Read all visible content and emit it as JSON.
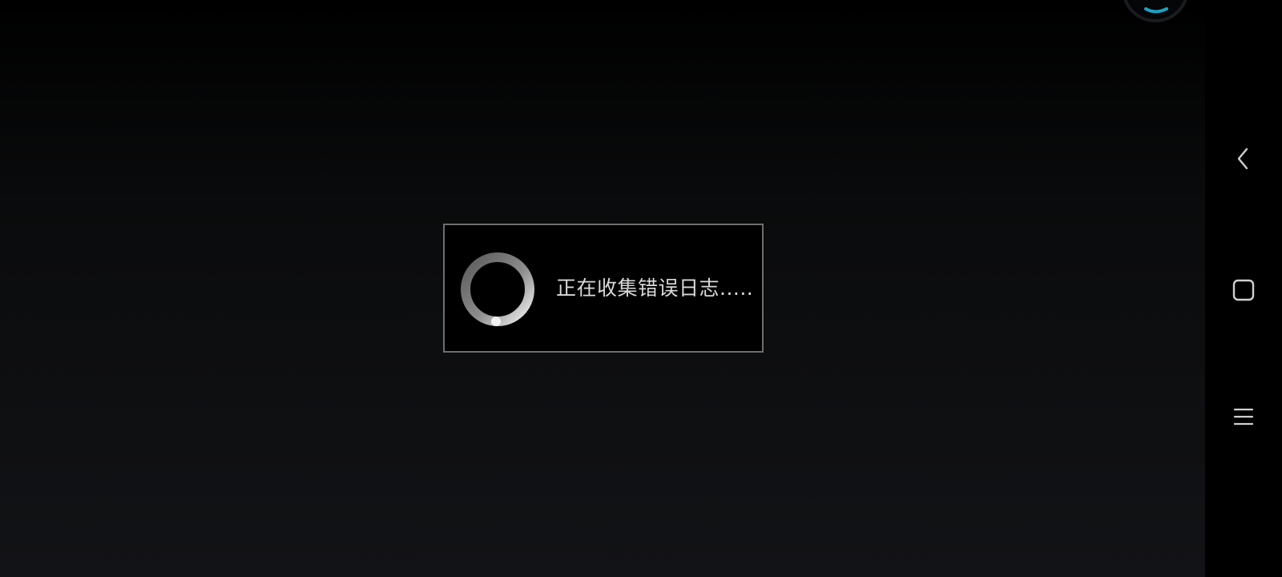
{
  "dialog": {
    "message": "正在收集错误日志....."
  },
  "colors": {
    "dialog_border": "#6e6e6e",
    "dialog_text": "#d9d9d9",
    "indicator_accent": "#1aa3c4"
  },
  "nav": {
    "back_icon": "chevron-left-icon",
    "home_icon": "rounded-square-icon",
    "recents_icon": "hamburger-menu-icon"
  },
  "overlay_icon": "floating-ball-icon",
  "spinner_icon": "loading-spinner-icon"
}
